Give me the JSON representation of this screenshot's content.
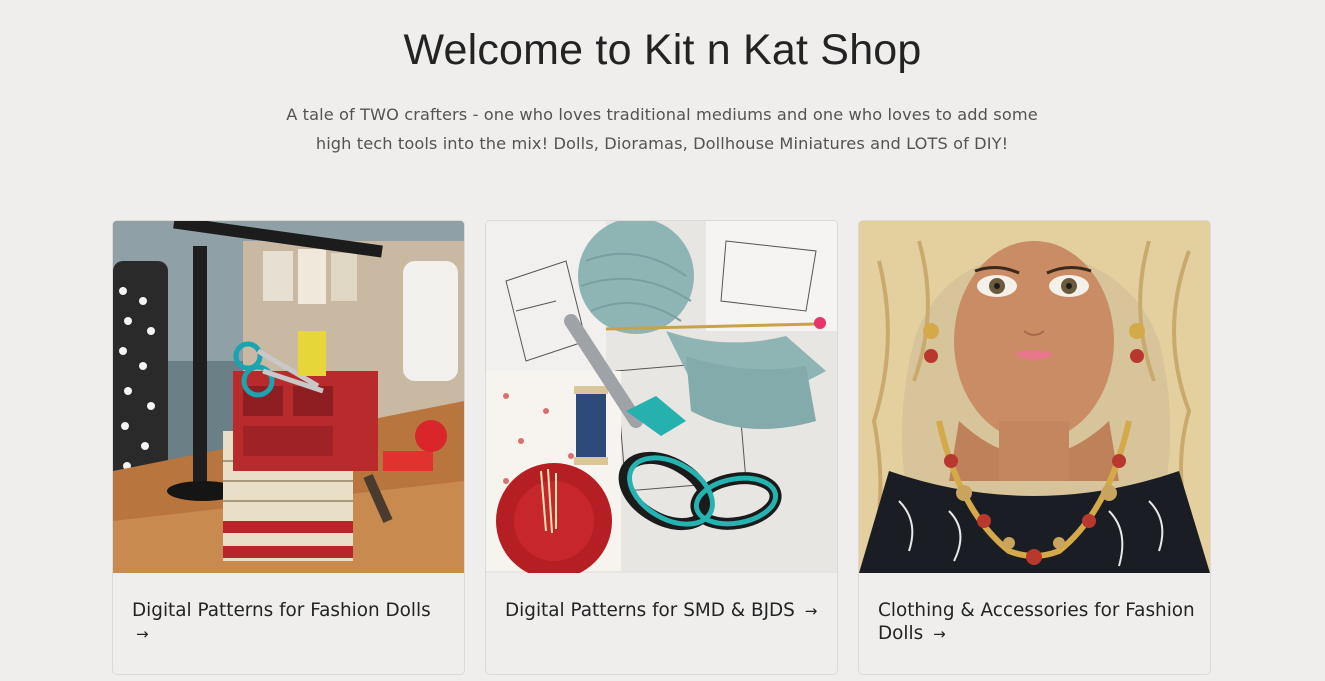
{
  "hero": {
    "title": "Welcome to Kit n Kat Shop",
    "subtitle": "A tale of TWO crafters - one who loves traditional mediums and one who loves to add some high tech tools into the mix! Dolls, Dioramas, Dollhouse Miniatures and LOTS of DIY!"
  },
  "cards": [
    {
      "title": "Digital Patterns for Fashion Dolls",
      "arrow": "→",
      "image": "miniature-sewing-basket-image"
    },
    {
      "title": "Digital Patterns for SMD & BJDS",
      "arrow": "→",
      "image": "patterns-yarn-scissors-image"
    },
    {
      "title": "Clothing & Accessories for Fashion Dolls",
      "arrow": "→",
      "image": "fashion-doll-jewelry-image"
    }
  ]
}
